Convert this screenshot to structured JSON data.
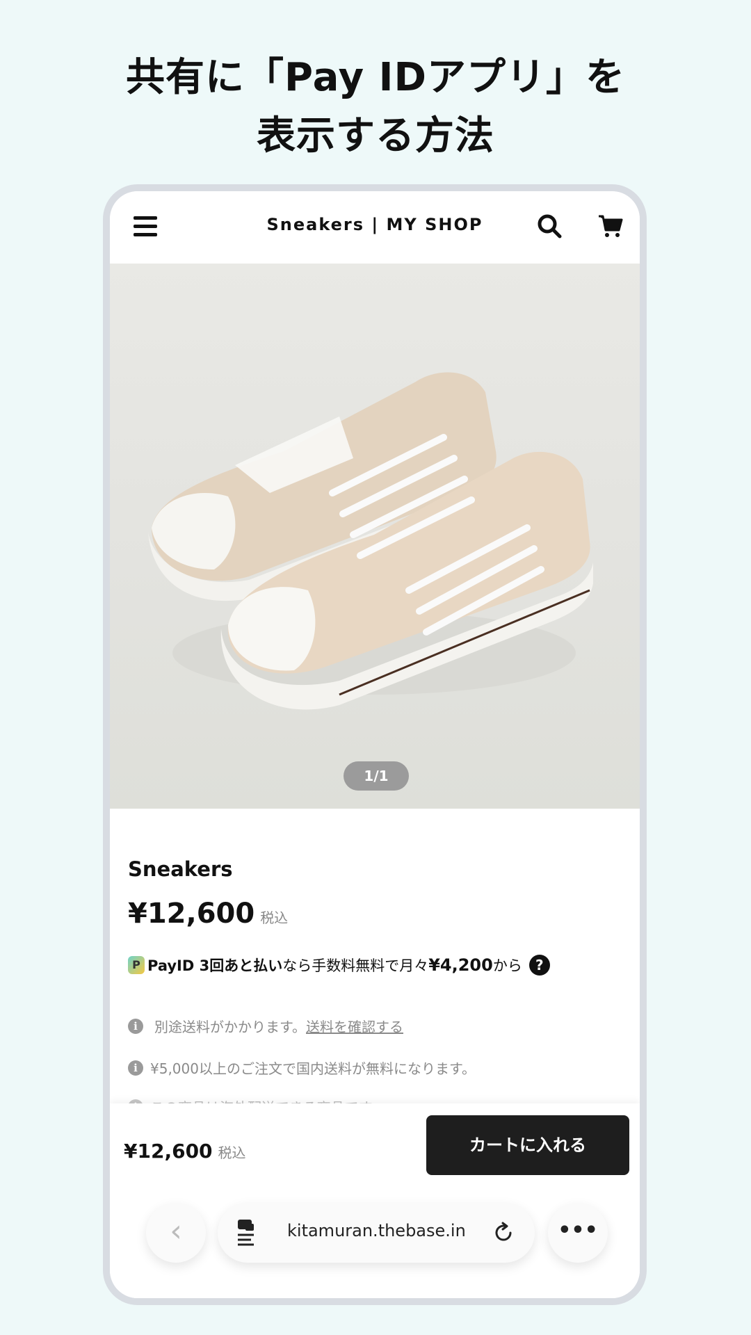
{
  "headline": {
    "line1": "共有に「Pay IDアプリ」を",
    "line2": "表示する方法"
  },
  "header": {
    "title": "Sneakers | MY SHOP",
    "menu_icon": "hamburger-menu-icon",
    "search_icon": "search-icon",
    "cart_icon": "cart-icon"
  },
  "gallery": {
    "counter": "1/1"
  },
  "product": {
    "name": "Sneakers",
    "price": "¥12,600",
    "tax_label": "税込"
  },
  "payid": {
    "logo_letter": "P",
    "brand": "PayID 3回あと払い",
    "text_before": "なら手数料無料で月々",
    "amount": "¥4,200",
    "text_after": "から",
    "help": "?"
  },
  "notes": {
    "shipping_text": "別途送料がかかります。",
    "shipping_link": "送料を確認する",
    "free_shipping": "¥5,000以上のご注文で国内送料が無料になります。",
    "overseas": "この商品は海外配送できる商品です。"
  },
  "bottom_bar": {
    "price": "¥12,600",
    "tax_label": "税込",
    "cart_button": "カートに入れる"
  },
  "browser": {
    "back": "‹",
    "url": "kitamuran.thebase.in",
    "more": "•••"
  },
  "colors": {
    "page_bg": "#eef9f9",
    "frame": "#d8dce2",
    "cart_button_bg": "#1e1e1e"
  }
}
